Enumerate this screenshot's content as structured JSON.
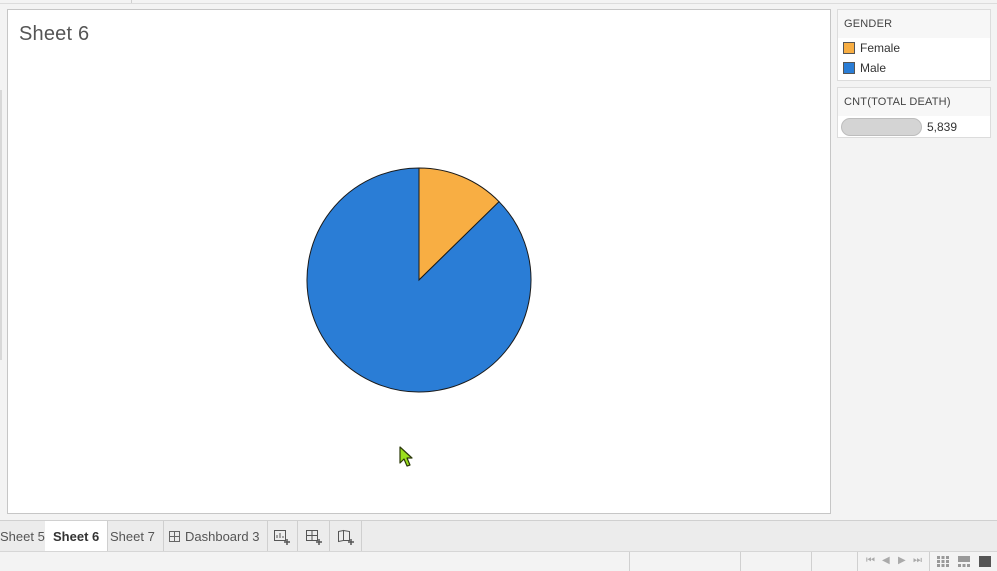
{
  "sheet": {
    "title": "Sheet 6"
  },
  "chart_data": {
    "type": "pie",
    "title": "Sheet 6",
    "measure": "CNT(TOTAL DEATH)",
    "total": 5839,
    "slices": [
      {
        "label": "Female",
        "value": 740,
        "color": "#f8ae43"
      },
      {
        "label": "Male",
        "value": 5099,
        "color": "#2a7dd6"
      }
    ]
  },
  "legend": {
    "color_title": "GENDER",
    "items": [
      {
        "label": "Female",
        "color": "#f8ae43"
      },
      {
        "label": "Male",
        "color": "#2a7dd6"
      }
    ],
    "size_title": "CNT(TOTAL DEATH)",
    "size_value": "5,839"
  },
  "tabs": [
    {
      "label": "Sheet 5",
      "active": false
    },
    {
      "label": "Sheet 6",
      "active": true
    },
    {
      "label": "Sheet 7",
      "active": false
    },
    {
      "label": "Dashboard 3",
      "active": false,
      "icon": "dashboard-icon"
    }
  ],
  "new_buttons": [
    "new-worksheet-icon",
    "new-dashboard-icon",
    "new-story-icon"
  ],
  "status_nav_icons": [
    "first-page-icon",
    "prev-page-icon",
    "next-page-icon",
    "last-page-icon"
  ],
  "view_icons": [
    "grid-view-icon",
    "filmstrip-view-icon",
    "tab-view-icon"
  ]
}
